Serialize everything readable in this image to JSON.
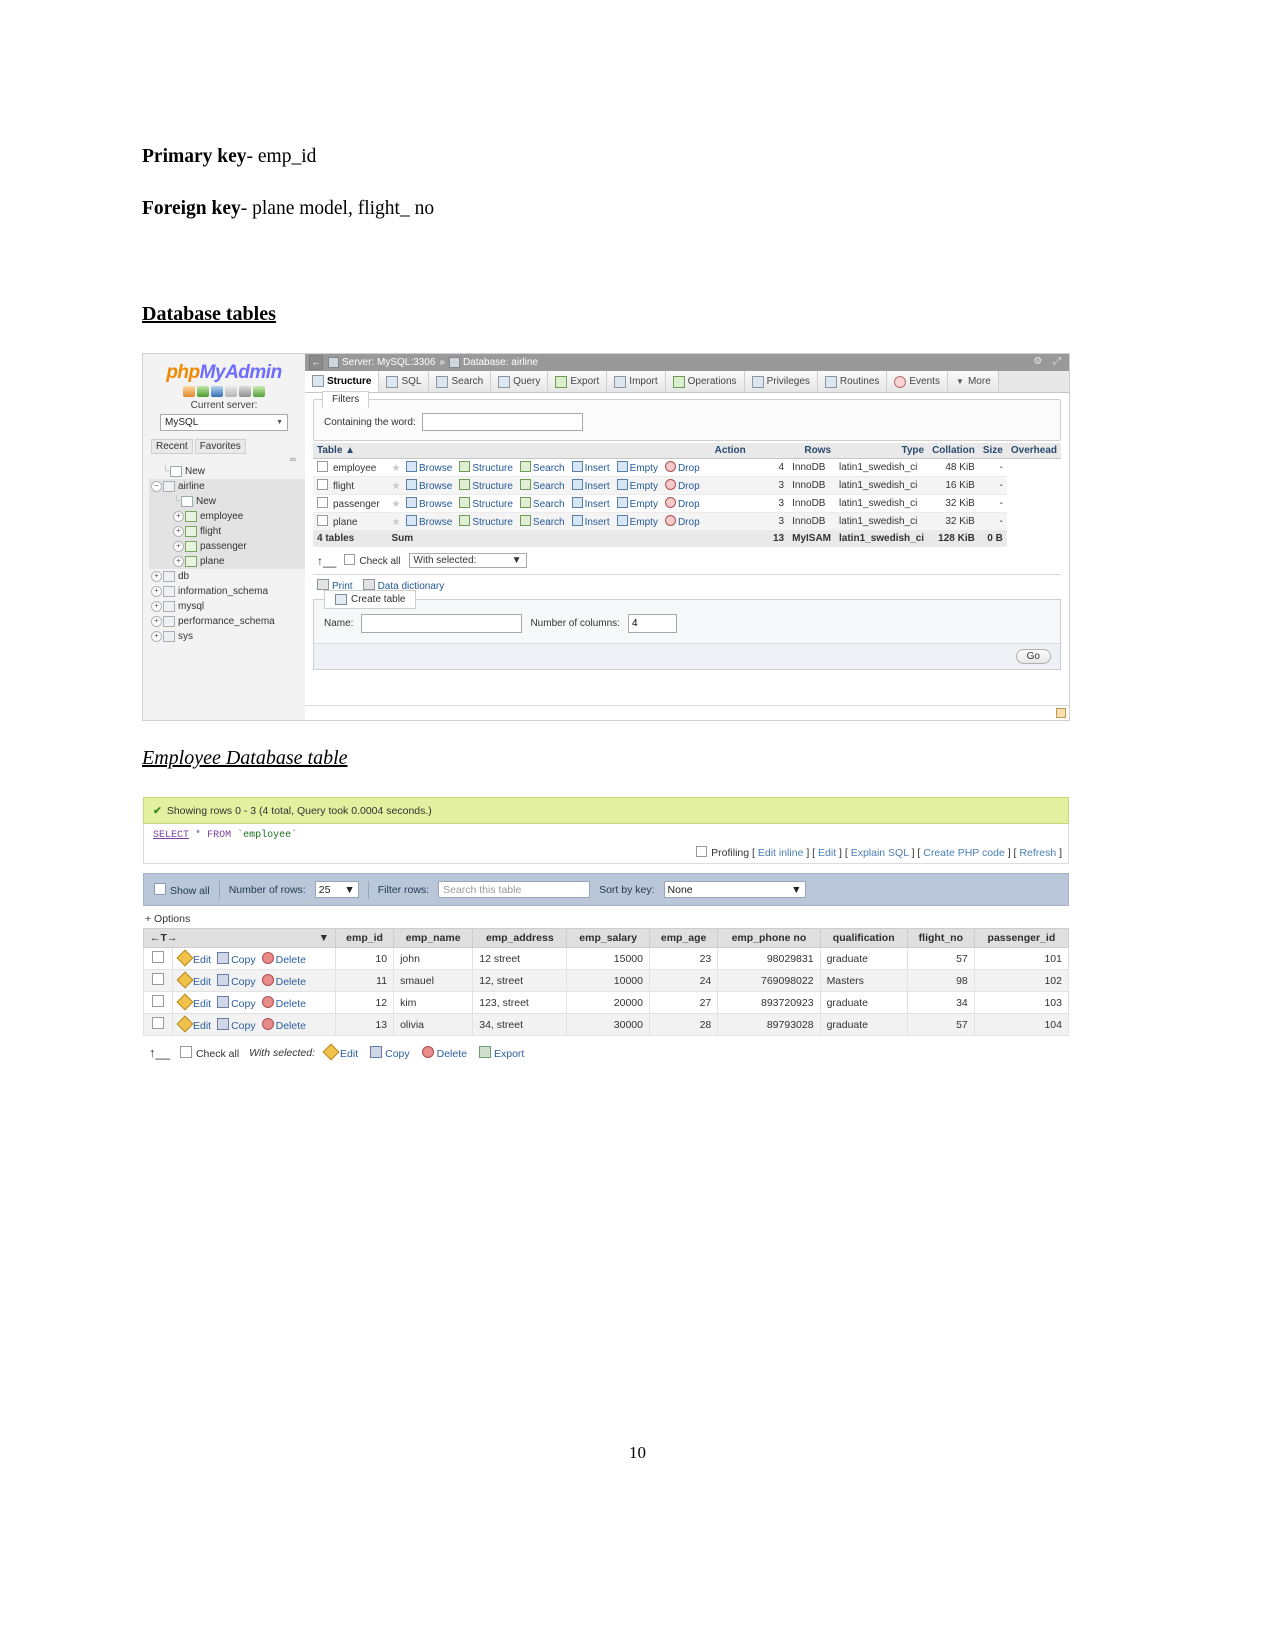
{
  "document": {
    "primary_key_label": "Primary key",
    "primary_key_value": "- emp_id",
    "foreign_key_label": "Foreign key",
    "foreign_key_value": "- plane model, flight_ no",
    "heading_database_tables": "Database tables",
    "heading_employee_table": "Employee Database table",
    "page_number": "10"
  },
  "pma": {
    "logo": {
      "php": "php",
      "my": "My",
      "admin": "Admin"
    },
    "icons": [
      "home-icon",
      "exit-icon",
      "docs-icon",
      "info-icon",
      "settings-icon",
      "refresh-icon"
    ],
    "current_server_label": "Current server:",
    "server_select_value": "MySQL",
    "recent_label": "Recent",
    "favorites_label": "Favorites",
    "tree": [
      {
        "label": "New",
        "depth": 1,
        "toggle": "",
        "icon": "new",
        "selected": false
      },
      {
        "label": "airline",
        "depth": 0,
        "toggle": "−",
        "icon": "db",
        "selected": true
      },
      {
        "label": "New",
        "depth": 2,
        "toggle": "",
        "icon": "new",
        "selected": true
      },
      {
        "label": "employee",
        "depth": 2,
        "toggle": "+",
        "icon": "tbl",
        "selected": true
      },
      {
        "label": "flight",
        "depth": 2,
        "toggle": "+",
        "icon": "tbl",
        "selected": true
      },
      {
        "label": "passenger",
        "depth": 2,
        "toggle": "+",
        "icon": "tbl",
        "selected": true
      },
      {
        "label": "plane",
        "depth": 2,
        "toggle": "+",
        "icon": "tbl",
        "selected": true
      },
      {
        "label": "db",
        "depth": 0,
        "toggle": "+",
        "icon": "db",
        "selected": false
      },
      {
        "label": "information_schema",
        "depth": 0,
        "toggle": "+",
        "icon": "db",
        "selected": false
      },
      {
        "label": "mysql",
        "depth": 0,
        "toggle": "+",
        "icon": "db",
        "selected": false
      },
      {
        "label": "performance_schema",
        "depth": 0,
        "toggle": "+",
        "icon": "db",
        "selected": false
      },
      {
        "label": "sys",
        "depth": 0,
        "toggle": "+",
        "icon": "db",
        "selected": false
      }
    ],
    "breadcrumb": {
      "back": "←",
      "server": "Server: MySQL:3306",
      "separator": "»",
      "database": "Database: airline"
    },
    "tabs": [
      {
        "label": "Structure",
        "active": true,
        "icon": "structure-icon"
      },
      {
        "label": "SQL",
        "active": false,
        "icon": "sql-icon"
      },
      {
        "label": "Search",
        "active": false,
        "icon": "search-icon"
      },
      {
        "label": "Query",
        "active": false,
        "icon": "query-icon"
      },
      {
        "label": "Export",
        "active": false,
        "icon": "export-icon"
      },
      {
        "label": "Import",
        "active": false,
        "icon": "import-icon"
      },
      {
        "label": "Operations",
        "active": false,
        "icon": "operations-icon"
      },
      {
        "label": "Privileges",
        "active": false,
        "icon": "privileges-icon"
      },
      {
        "label": "Routines",
        "active": false,
        "icon": "routines-icon"
      },
      {
        "label": "Events",
        "active": false,
        "icon": "events-icon"
      },
      {
        "label": "More",
        "active": false,
        "icon": "more-icon"
      }
    ],
    "filters": {
      "legend": "Filters",
      "containing_label": "Containing the word:",
      "containing_value": ""
    },
    "table_list": {
      "headers": [
        "Table",
        "Action",
        "Rows",
        "Type",
        "Collation",
        "Size",
        "Overhead"
      ],
      "sort_marker": "▲",
      "actions": [
        "Browse",
        "Structure",
        "Search",
        "Insert",
        "Empty",
        "Drop"
      ],
      "rows": [
        {
          "name": "employee",
          "rows": "4",
          "type": "InnoDB",
          "collation": "latin1_swedish_ci",
          "size": "48 KiB",
          "overhead": "-"
        },
        {
          "name": "flight",
          "rows": "3",
          "type": "InnoDB",
          "collation": "latin1_swedish_ci",
          "size": "16 KiB",
          "overhead": "-"
        },
        {
          "name": "passenger",
          "rows": "3",
          "type": "InnoDB",
          "collation": "latin1_swedish_ci",
          "size": "32 KiB",
          "overhead": "-"
        },
        {
          "name": "plane",
          "rows": "3",
          "type": "InnoDB",
          "collation": "latin1_swedish_ci",
          "size": "32 KiB",
          "overhead": "-"
        }
      ],
      "sum": {
        "count": "4 tables",
        "label": "Sum",
        "rows": "13",
        "type": "MyISAM",
        "collation": "latin1_swedish_ci",
        "size": "128 KiB",
        "overhead": "0 B"
      }
    },
    "footer": {
      "check_all": "Check all",
      "with_selected": "With selected:",
      "print": "Print",
      "data_dictionary": "Data dictionary"
    },
    "create_table": {
      "legend": "Create table",
      "name_label": "Name:",
      "name_value": "",
      "columns_label": "Number of columns:",
      "columns_value": "4",
      "go_label": "Go"
    }
  },
  "emp": {
    "status": "Showing rows 0 - 3 (4 total, Query took 0.0004 seconds.)",
    "sql": {
      "select": "SELECT",
      "star": "*",
      "from": "FROM",
      "table": "`employee`"
    },
    "profiling": {
      "label": "Profiling",
      "links": [
        "Edit inline",
        "Edit",
        "Explain SQL",
        "Create PHP code",
        "Refresh"
      ]
    },
    "controls": {
      "show_all": "Show all",
      "number_of_rows_label": "Number of rows:",
      "number_of_rows_value": "25",
      "filter_rows_label": "Filter rows:",
      "filter_rows_placeholder": "Search this table",
      "sort_by_key_label": "Sort by key:",
      "sort_by_key_value": "None"
    },
    "options_label": "+ Options",
    "nav_header": "←T→",
    "row_actions": [
      "Edit",
      "Copy",
      "Delete"
    ],
    "columns": [
      "emp_id",
      "emp_name",
      "emp_address",
      "emp_salary",
      "emp_age",
      "emp_phone no",
      "qualification",
      "flight_no",
      "passenger_id"
    ],
    "rows": [
      [
        "10",
        "john",
        "12 street",
        "15000",
        "23",
        "98029831",
        "graduate",
        "57",
        "101"
      ],
      [
        "11",
        "smauel",
        "12, street",
        "10000",
        "24",
        "769098022",
        "Masters",
        "98",
        "102"
      ],
      [
        "12",
        "kim",
        "123, street",
        "20000",
        "27",
        "893720923",
        "graduate",
        "34",
        "103"
      ],
      [
        "13",
        "olivia",
        "34, street",
        "30000",
        "28",
        "89793028",
        "graduate",
        "57",
        "104"
      ]
    ],
    "bottom": {
      "check_all": "Check all",
      "with_selected": "With selected:",
      "actions": [
        "Edit",
        "Copy",
        "Delete",
        "Export"
      ]
    }
  }
}
